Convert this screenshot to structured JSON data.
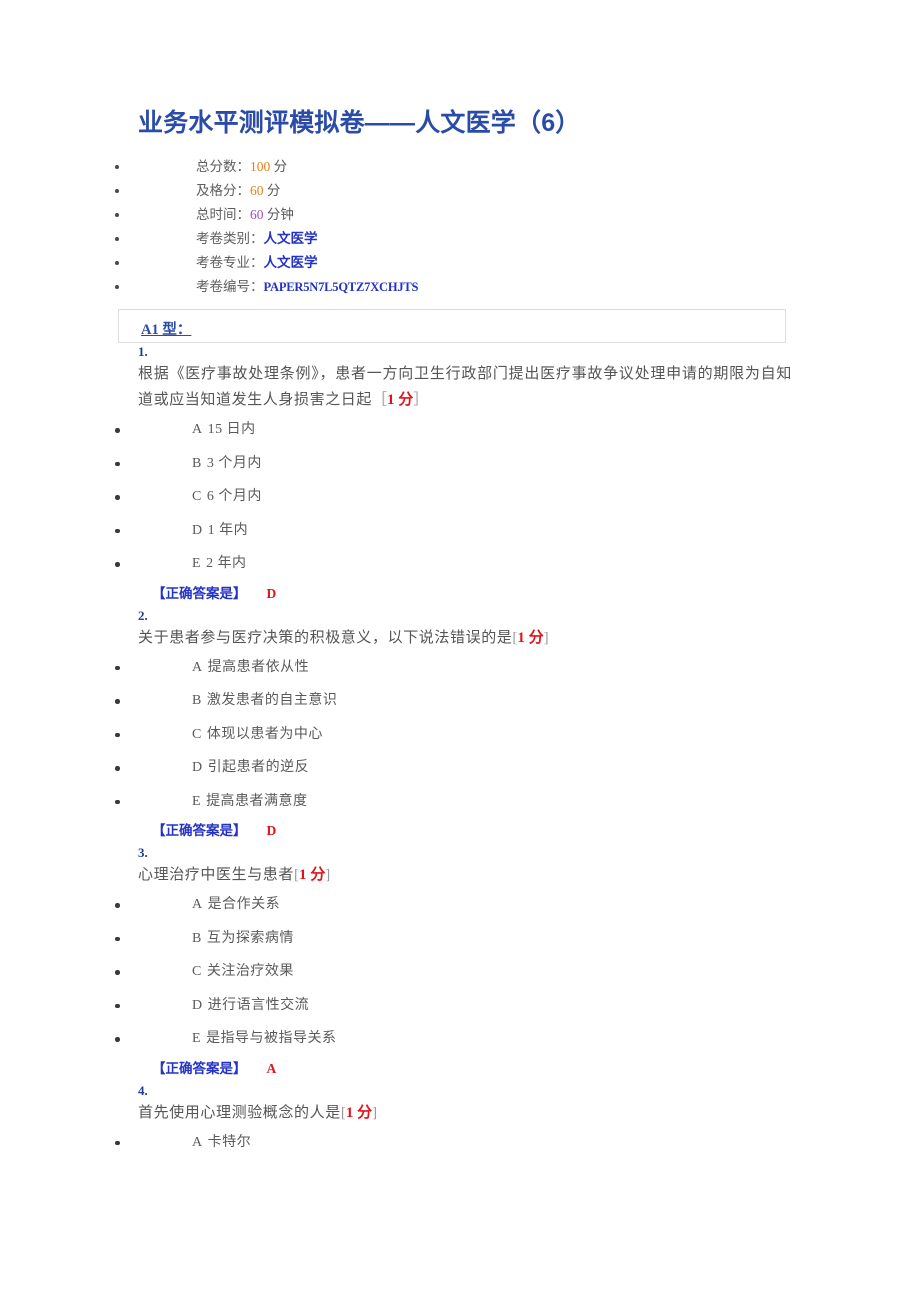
{
  "document": {
    "title": "业务水平测评模拟卷——人文医学（6）"
  },
  "meta": [
    {
      "label": "总分数：",
      "value": "100",
      "unit": "分",
      "value_color": "#e8811a"
    },
    {
      "label": "及格分：",
      "value": "60",
      "unit": "分",
      "value_color": "#e8811a"
    },
    {
      "label": "总时间：",
      "value": "60",
      "unit": "分钟",
      "value_color": "#9b4fc8"
    },
    {
      "label": "考卷类别：",
      "value": "人文医学",
      "unit": "",
      "value_color": "#2433c6"
    },
    {
      "label": "考卷专业：",
      "value": "人文医学",
      "unit": "",
      "value_color": "#2433c6"
    },
    {
      "label": "考卷编号：",
      "value": "PAPER5N7L5QTZ7XCHJTS",
      "unit": "",
      "value_color": "#2433c6"
    }
  ],
  "section": {
    "title": "A1 型："
  },
  "answer_label": "【正确答案是】",
  "questions": [
    {
      "number": "1.",
      "text": "根据《医疗事故处理条例》，患者一方向卫生行政部门提出医疗事故争议处理申请的期限为自知道或应当知道发生人身损害之日起",
      "points_open": "［",
      "points": "1 分",
      "points_close": "］",
      "options": [
        {
          "letter": "A",
          "text": "15 日内"
        },
        {
          "letter": "B",
          "text": "3 个月内"
        },
        {
          "letter": "C",
          "text": "6 个月内"
        },
        {
          "letter": "D",
          "text": "1 年内"
        },
        {
          "letter": "E",
          "text": "2 年内"
        }
      ],
      "answer": "D"
    },
    {
      "number": "2.",
      "text": "关于患者参与医疗决策的积极意义，以下说法错误的是",
      "points_open": "[",
      "points": "1 分",
      "points_close": "]",
      "options": [
        {
          "letter": "A",
          "text": "提高患者依从性"
        },
        {
          "letter": "B",
          "text": "激发患者的自主意识"
        },
        {
          "letter": "C",
          "text": "体现以患者为中心"
        },
        {
          "letter": "D",
          "text": "引起患者的逆反"
        },
        {
          "letter": "E",
          "text": "提高患者满意度"
        }
      ],
      "answer": "D"
    },
    {
      "number": "3.",
      "text": "心理治疗中医生与患者",
      "points_open": "[",
      "points": "1 分",
      "points_close": "]",
      "options": [
        {
          "letter": "A",
          "text": "是合作关系"
        },
        {
          "letter": "B",
          "text": "互为探索病情"
        },
        {
          "letter": "C",
          "text": "关注治疗效果"
        },
        {
          "letter": "D",
          "text": "进行语言性交流"
        },
        {
          "letter": "E",
          "text": "是指导与被指导关系"
        }
      ],
      "answer": "A"
    },
    {
      "number": "4.",
      "text": "首先使用心理测验概念的人是",
      "points_open": "[",
      "points": "1 分",
      "points_close": "]",
      "options": [
        {
          "letter": "A",
          "text": "卡特尔"
        }
      ],
      "answer": ""
    }
  ]
}
